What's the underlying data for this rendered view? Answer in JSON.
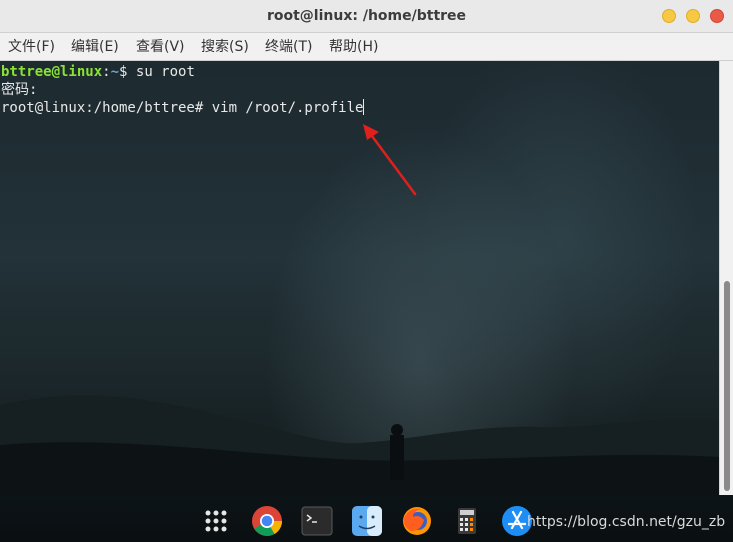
{
  "window": {
    "title": "root@linux: /home/bttree"
  },
  "menu": [
    {
      "label": "文件(F)"
    },
    {
      "label": "编辑(E)"
    },
    {
      "label": "查看(V)"
    },
    {
      "label": "搜索(S)"
    },
    {
      "label": "终端(T)"
    },
    {
      "label": "帮助(H)"
    }
  ],
  "terminal": {
    "line1_user": "bttree@linux",
    "line1_sep": ":",
    "line1_path": "~",
    "line1_cmd": "$ su root",
    "line2": "密码:",
    "line3": "root@linux:/home/bttree# vim /root/.profile"
  },
  "dock": {
    "icons": [
      "apps-grid-icon",
      "chrome-icon",
      "terminal-icon",
      "finder-icon",
      "firefox-icon",
      "calculator-icon",
      "app-store-icon"
    ]
  },
  "watermark": "https://blog.csdn.net/gzu_zb",
  "colors": {
    "user": "#8ae234",
    "path": "#729fcf",
    "arrow": "#e0201d",
    "close": "#ea5a48",
    "minmax": "#f7c844"
  }
}
